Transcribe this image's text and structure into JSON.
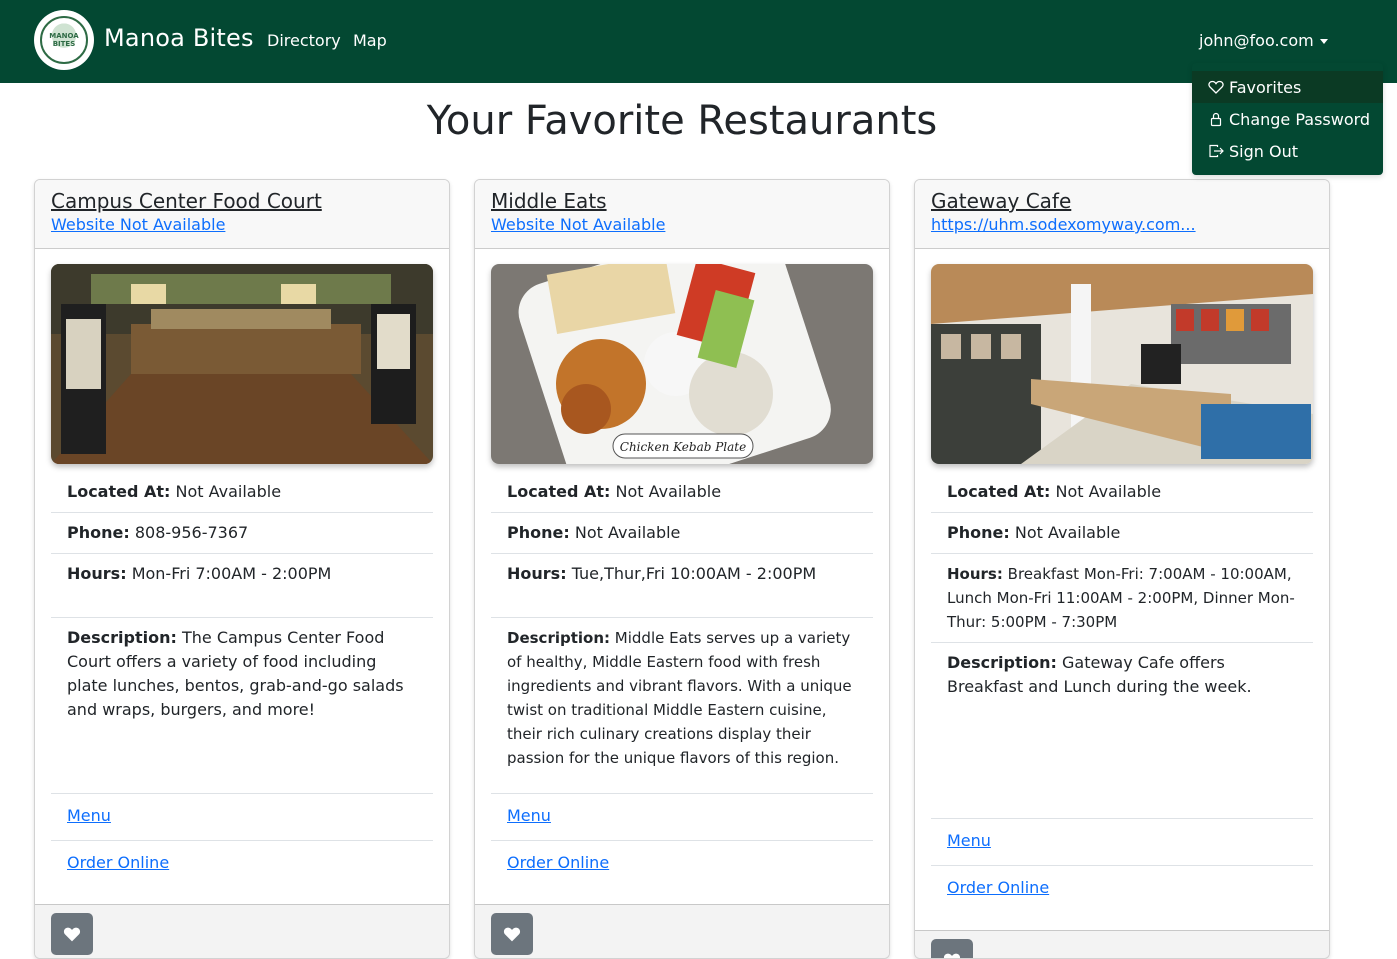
{
  "navbar": {
    "logo_text": "MANOA BITES",
    "brand": "Manoa Bites",
    "links": [
      "Directory",
      "Map"
    ],
    "user": "john@foo.com"
  },
  "dropdown": {
    "items": [
      {
        "label": "Favorites",
        "icon": "heart-icon"
      },
      {
        "label": "Change Password",
        "icon": "lock-icon"
      },
      {
        "label": "Sign Out",
        "icon": "sign-out-icon"
      }
    ]
  },
  "page": {
    "title": "Your Favorite Restaurants"
  },
  "labels": {
    "located": "Located At:",
    "phone": "Phone:",
    "hours": "Hours:",
    "description": "Description:",
    "menu": "Menu",
    "order": "Order Online"
  },
  "restaurants": [
    {
      "name": "Campus Center Food Court",
      "website": "Website Not Available",
      "located": "Not Available",
      "phone": "808-956-7367",
      "hours": "Mon-Fri 7:00AM - 2:00PM",
      "description": "The Campus Center Food Court offers a variety of food including plate lunches, bentos, grab-and-go salads and wraps, burgers, and more!"
    },
    {
      "name": "Middle Eats",
      "website": "Website Not Available",
      "located": "Not Available",
      "phone": "Not Available",
      "hours": "Tue,Thur,Fri 10:00AM - 2:00PM",
      "description": "Middle Eats serves up a variety of healthy, Middle Eastern food with fresh ingredients and vibrant flavors. With a unique twist on traditional Middle Eastern cuisine, their rich culinary creations display their passion for the unique flavors of this region.",
      "image_caption": "Chicken Kebab Plate"
    },
    {
      "name": "Gateway Cafe",
      "website": "https://uhm.sodexomyway.com...",
      "located": "Not Available",
      "phone": "Not Available",
      "hours": "Breakfast Mon-Fri: 7:00AM - 10:00AM, Lunch Mon-Fri 11:00AM - 2:00PM, Dinner Mon-Thur: 5:00PM - 7:30PM",
      "description": "Gateway Cafe offers Breakfast and Lunch during the week."
    }
  ]
}
